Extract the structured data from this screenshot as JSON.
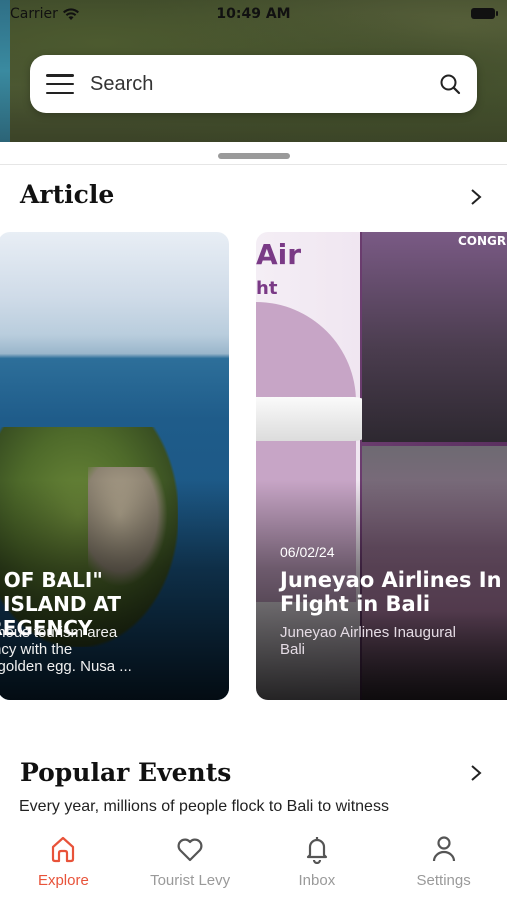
{
  "status_bar": {
    "carrier": "Carrier",
    "time": "10:49 AM"
  },
  "search": {
    "placeholder": "Search"
  },
  "articles": {
    "title": "Article",
    "cards": [
      {
        "headline": "GG OF BALI\"\nDA ISLAND AT\nG REGENCY",
        "excerpt": "a famous tourism area\negency with the\nali's golden egg. Nusa ..."
      },
      {
        "date": "06/02/24",
        "headline": "Juneyao Airlines In\nFlight in Bali",
        "excerpt": "Juneyao Airlines Inaugural\nBali",
        "image_text_air": "Air",
        "image_text_ht": "ht",
        "image_text_congr": "CONGR"
      }
    ]
  },
  "events": {
    "title": "Popular Events",
    "description": "Every year, millions of people flock to Bali to witness"
  },
  "bottom_nav": {
    "items": [
      {
        "label": "Explore",
        "icon": "home-icon",
        "active": true
      },
      {
        "label": "Tourist Levy",
        "icon": "heart-icon",
        "active": false
      },
      {
        "label": "Inbox",
        "icon": "bell-icon",
        "active": false
      },
      {
        "label": "Settings",
        "icon": "user-icon",
        "active": false
      }
    ]
  },
  "colors": {
    "accent": "#e8533a",
    "inactive": "#9a9a9a"
  }
}
